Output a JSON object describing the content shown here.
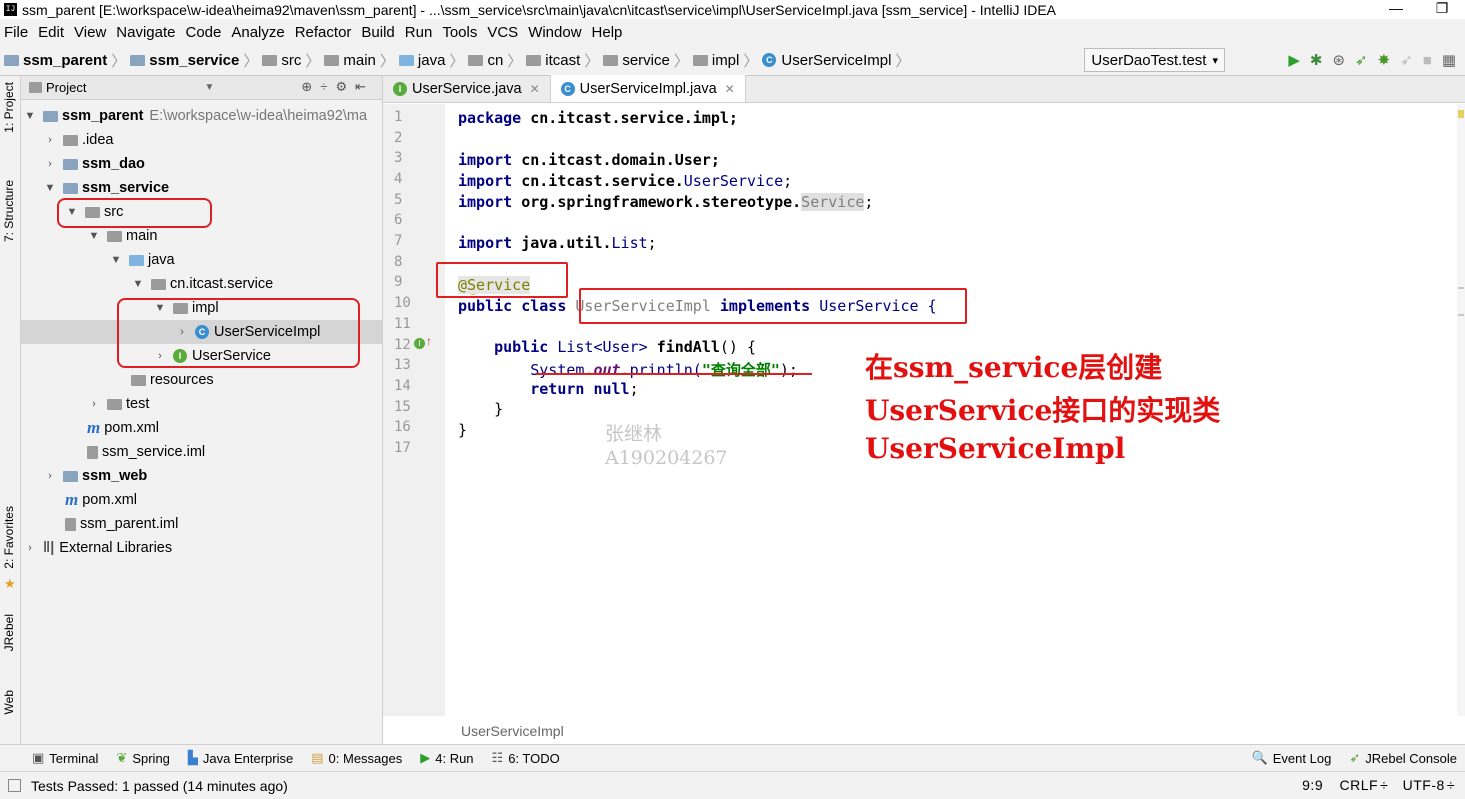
{
  "title": "ssm_parent [E:\\workspace\\w-idea\\heima92\\maven\\ssm_parent] - ...\\ssm_service\\src\\main\\java\\cn\\itcast\\service\\impl\\UserServiceImpl.java [ssm_service] - IntelliJ IDEA",
  "window": {
    "minimize": "—",
    "restore": "❐"
  },
  "menu": [
    "File",
    "Edit",
    "View",
    "Navigate",
    "Code",
    "Analyze",
    "Refactor",
    "Build",
    "Run",
    "Tools",
    "VCS",
    "Window",
    "Help"
  ],
  "breadcrumb": [
    "ssm_parent",
    "ssm_service",
    "src",
    "main",
    "java",
    "cn",
    "itcast",
    "service",
    "impl",
    "UserServiceImpl"
  ],
  "run_config": "UserDaoTest.test",
  "left_tabs": {
    "project": "1: Project",
    "structure": "7: Structure",
    "favorites": "2: Favorites",
    "jrebel": "JRebel",
    "web": "Web"
  },
  "project": {
    "header": "Project",
    "tree": [
      {
        "label": "ssm_parent",
        "extra": "E:\\workspace\\w-idea\\heima92\\ma",
        "bold": true
      },
      {
        "label": ".idea"
      },
      {
        "label": "ssm_dao",
        "bold": true
      },
      {
        "label": "ssm_service",
        "bold": true
      },
      {
        "label": "src"
      },
      {
        "label": "main"
      },
      {
        "label": "java"
      },
      {
        "label": "cn.itcast.service"
      },
      {
        "label": "impl"
      },
      {
        "label": "UserServiceImpl"
      },
      {
        "label": "UserService"
      },
      {
        "label": "resources"
      },
      {
        "label": "test"
      },
      {
        "label": "pom.xml"
      },
      {
        "label": "ssm_service.iml"
      },
      {
        "label": "ssm_web",
        "bold": true
      },
      {
        "label": "pom.xml"
      },
      {
        "label": "ssm_parent.iml"
      },
      {
        "label": "External Libraries"
      }
    ]
  },
  "editor": {
    "tabs": [
      "UserService.java",
      "UserServiceImpl.java"
    ],
    "line_numbers": [
      "1",
      "2",
      "3",
      "4",
      "5",
      "6",
      "7",
      "8",
      "9",
      "10",
      "11",
      "12",
      "13",
      "14",
      "15",
      "16",
      "17"
    ],
    "code": {
      "l1_kw": "package",
      "l1_rest": " cn.itcast.service.impl;",
      "l3_kw": "import",
      "l3_rest": " cn.itcast.domain.User;",
      "l4_kw": "import",
      "l4_a": " cn.itcast.service.",
      "l4_b": "UserService",
      "l4_c": ";",
      "l5_kw": "import",
      "l5_a": " org.springframework.stereotype.",
      "l5_b": "Service",
      "l5_c": ";",
      "l7_kw": "import",
      "l7_a": " java.util.",
      "l7_b": "List",
      "l7_c": ";",
      "l9": "@Service",
      "l10_kw": "public class",
      "l10_a": " UserServiceImpl ",
      "l10_b": "implements",
      "l10_c": " UserService {",
      "l12_kw": "public",
      "l12_a": " List<User> ",
      "l12_b": "findAll",
      "l12_c": "() {",
      "l13_a": "System.",
      "l13_b": "out",
      "l13_c": ".println(",
      "l13_d": "\"查询全部\"",
      "l13_e": ");",
      "l14_kw": "return",
      "l14_a": " ",
      "l14_b": "null",
      "l14_c": ";",
      "l15": "}",
      "l16": "}"
    },
    "annotation": [
      "在ssm_service层创建",
      "UserService接口的实现类",
      "UserServiceImpl"
    ],
    "watermark": [
      "张继林",
      "A190204267"
    ],
    "footer_crumb": "UserServiceImpl"
  },
  "toolwindows": [
    "Terminal",
    "Spring",
    "Java Enterprise",
    "0: Messages",
    "4: Run",
    "6: TODO"
  ],
  "toolwindows_right": [
    "Event Log",
    "JRebel Console"
  ],
  "status": {
    "message": "Tests Passed: 1 passed (14 minutes ago)",
    "position": "9:9",
    "line_sep": "CRLF",
    "encoding": "UTF-8"
  }
}
